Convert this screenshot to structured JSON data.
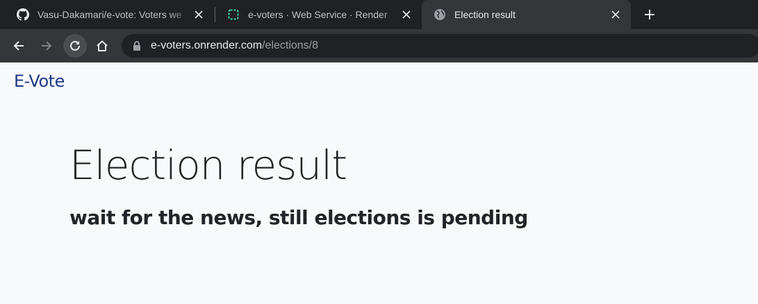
{
  "tabs": [
    {
      "title": "Vasu-Dakamari/e-vote: Voters we",
      "icon": "github-icon",
      "active": false
    },
    {
      "title": "e-voters · Web Service · Render",
      "icon": "render-icon",
      "active": false
    },
    {
      "title": "Election result",
      "icon": "globe-icon",
      "active": true
    }
  ],
  "address_bar": {
    "host": "e-voters.onrender.com",
    "path": "/elections/8"
  },
  "page": {
    "brand": "E-Vote",
    "title": "Election result",
    "message": "wait for the news, still elections is pending"
  },
  "colors": {
    "tabstrip_bg": "#202124",
    "toolbar_bg": "#35363a",
    "brand": "#1e3a8a",
    "render_icon": "#46e3b7",
    "page_bg": "#f8f9fa"
  }
}
